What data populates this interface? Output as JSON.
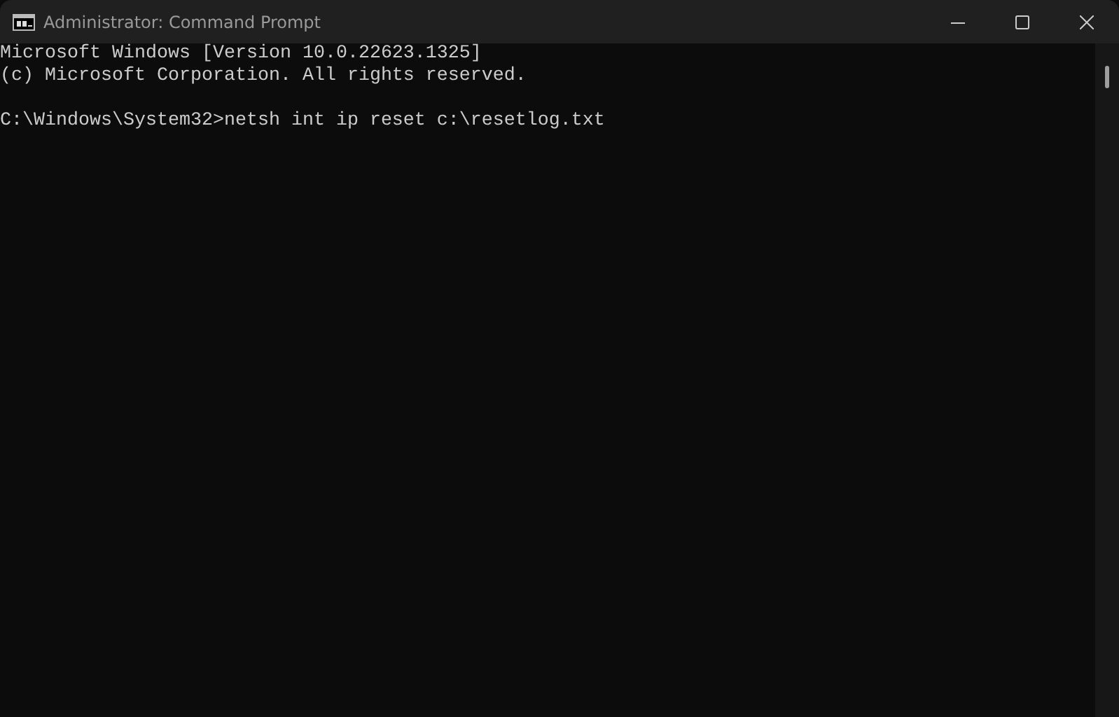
{
  "window": {
    "title": "Administrator: Command Prompt"
  },
  "console": {
    "banner": [
      "Microsoft Windows [Version 10.0.22623.1325]",
      "(c) Microsoft Corporation. All rights reserved."
    ],
    "prompt": "C:\\Windows\\System32>netsh int ip reset c:\\resetlog.txt"
  }
}
